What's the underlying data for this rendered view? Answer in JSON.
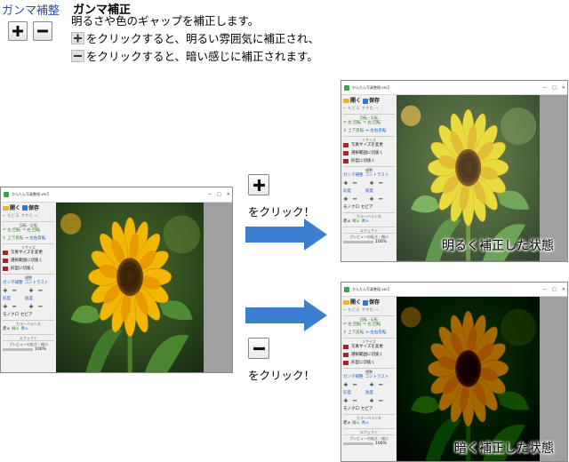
{
  "header": {
    "control_label": "ガンマ補整",
    "title": "ガンマ補正",
    "line1": "明るさや色のギャップを補正します。",
    "line2": "をクリックすると、明るい雰囲気に補正され、",
    "line3": "をクリックすると、暗い感じに補正されます。"
  },
  "window": {
    "title": "かんたん写真整理.ver2",
    "controls": [
      "—",
      "□",
      "✕"
    ],
    "open": "開く",
    "save": "保存",
    "back": "もどる",
    "forward": "すすむ",
    "rotate_section": "回転・反転",
    "rotate_left": "左 回転",
    "rotate_right": "右 回転",
    "flip_vertical": "上下反転",
    "flip_horizontal": "左右反転",
    "resize_section": "リサイズ",
    "resize_size": "写真サイズを変更",
    "crop": "選択範囲に切抜く",
    "shape_crop": "形型に切抜く",
    "adjust_section": "補整",
    "gamma": "ガンマ補整",
    "contrast": "コントラスト",
    "brightness": "彩度",
    "sharpness": "鋭度",
    "mono": "モノクロ",
    "sepia": "セピア",
    "color_balance": "カラーバランス",
    "red": "赤",
    "green": "緑",
    "blue": "青",
    "effect": "エフェクト",
    "preview": "プレビューの拡大・縮小",
    "zoom": "100%"
  },
  "steps": {
    "plus_label": "をクリック！",
    "minus_label": "をクリック！"
  },
  "results": {
    "bright": "明るく補正した状態",
    "dark": "暗く補正した状態"
  },
  "colors": {
    "arrow": "#3b7fd1",
    "accent": "#2f4fa8"
  }
}
